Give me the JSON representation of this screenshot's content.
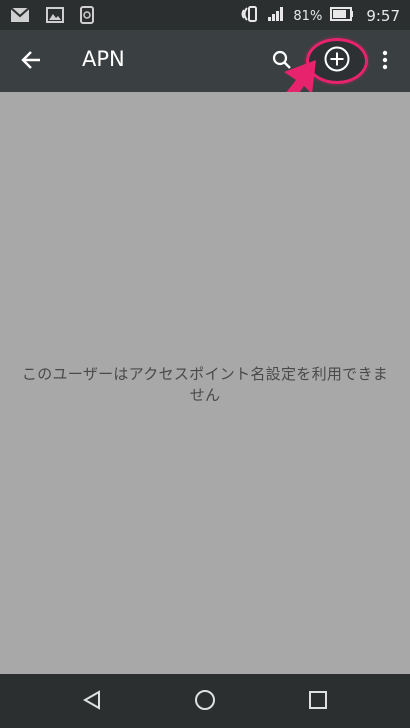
{
  "status_bar": {
    "battery_percent": "81%",
    "time": "9:57",
    "left_icons": [
      "mail-icon",
      "image-icon",
      "sim-icon"
    ],
    "right_icons": [
      "nfc-icon",
      "signal-icon",
      "battery-icon"
    ]
  },
  "toolbar": {
    "title": "APN",
    "back_icon": "arrow-back-icon",
    "search_icon": "search-icon",
    "add_icon": "add-circle-icon",
    "more_icon": "more-vert-icon",
    "highlight_color": "#e8236e"
  },
  "content": {
    "message": "このユーザーはアクセスポイント名設定を利用できません"
  },
  "nav_bar": {
    "buttons": [
      "back-triangle-icon",
      "home-circle-icon",
      "recents-square-icon"
    ]
  }
}
